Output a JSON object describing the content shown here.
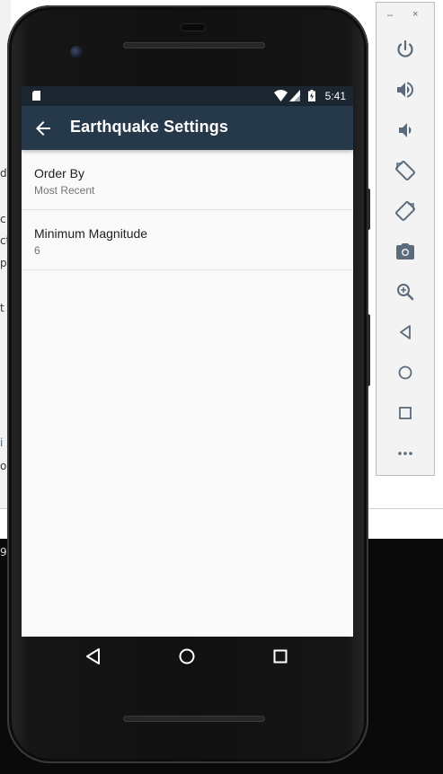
{
  "desktop": {
    "fragments": [
      "d",
      "c",
      "ct",
      "pa",
      "t",
      "i",
      "o",
      "9"
    ]
  },
  "status_bar": {
    "time": "5:41",
    "icons": [
      "sd-card-icon",
      "wifi-icon",
      "signal-icon",
      "battery-charging-icon"
    ]
  },
  "toolbar": {
    "title": "Earthquake Settings",
    "back_icon": "arrow-back-icon"
  },
  "preferences": [
    {
      "title": "Order By",
      "summary": "Most Recent"
    },
    {
      "title": "Minimum Magnitude",
      "summary": "6"
    }
  ],
  "nav_bar": {
    "buttons": [
      "back-triangle-icon",
      "home-circle-icon",
      "overview-square-icon"
    ]
  },
  "emulator_panel": {
    "minimize": "–",
    "close": "×",
    "buttons": [
      "power-icon",
      "volume-up-icon",
      "volume-down-icon",
      "rotate-left-icon",
      "rotate-right-icon",
      "camera-icon",
      "zoom-icon",
      "back-icon",
      "home-icon",
      "overview-icon",
      "more-icon"
    ]
  },
  "colors": {
    "toolbar": "#26394a",
    "status_bar": "#1b2631",
    "screen_bg": "#fafafa"
  }
}
